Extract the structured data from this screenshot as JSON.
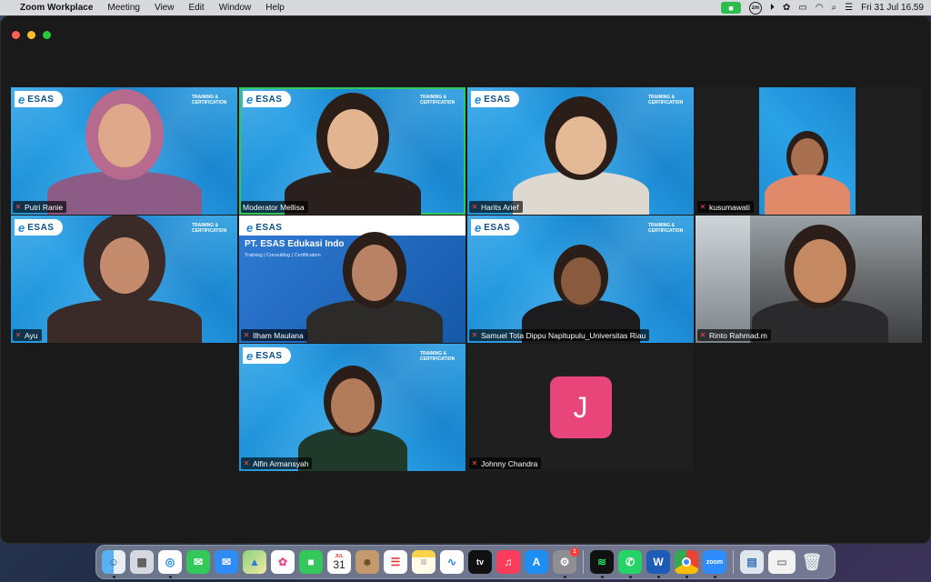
{
  "menubar": {
    "app_name": "Zoom Workplace",
    "items": [
      "Meeting",
      "View",
      "Edit",
      "Window",
      "Help"
    ],
    "zm_label": "zm",
    "clock": "Fri 31 Jul  16.59"
  },
  "tiles": [
    {
      "name": "Putri Ranie",
      "logo": "ESAS",
      "training": "TRAINING & CERTIFICATION"
    },
    {
      "name": "Moderator Mellisa",
      "logo": "ESAS",
      "training": "TRAINING & CERTIFICATION"
    },
    {
      "name": "Harits Arief",
      "logo": "ESAS",
      "training": "TRAINING & CERTIFICATION"
    },
    {
      "name": "kusumawati"
    },
    {
      "name": "Ayu",
      "logo": "ESAS",
      "training": "TRAINING & CERTIFICATION"
    },
    {
      "name": "Ilham Maulana",
      "logo": "ESAS",
      "slide_title": "PT. ESAS Edukasi Indo",
      "slide_sub": "Training | Consulting | Certification"
    },
    {
      "name": "Samuel Tota Dippu Napitupulu_Universitas Riau",
      "logo": "ESAS",
      "training": "TRAINING & CERTIFICATION"
    },
    {
      "name": "Rinto Rahmad.m"
    },
    {
      "name": "Alfin Armansyah",
      "logo": "ESAS",
      "training": "TRAINING & CERTIFICATION"
    },
    {
      "name": "Johnny Chandra",
      "initial": "J"
    }
  ],
  "dock": {
    "calendar_month": "JUL",
    "calendar_day": "31",
    "appstore_badge": "1",
    "tv_label": "tv",
    "zoom_label": "zoom"
  },
  "colors": {
    "active_speaker": "#32c85a",
    "avatar_bg": "#e8457a",
    "tile_blue": "#1d8fd6"
  }
}
